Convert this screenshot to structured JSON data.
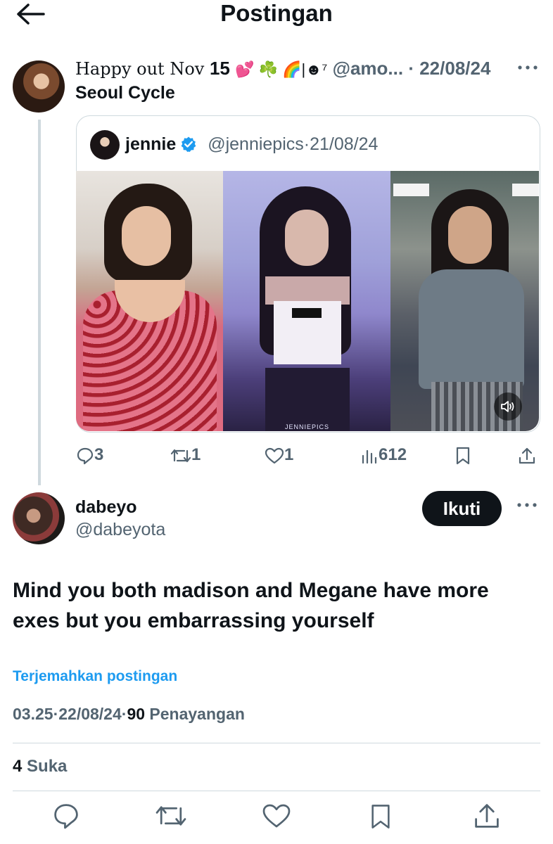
{
  "header": {
    "title": "Postingan"
  },
  "parent_post": {
    "display_name_prefix": "Happy out Nov ",
    "display_name_num": "15",
    "display_name_emoji": "💕 ☘️ 🌈|☻⁷",
    "handle": "@amo...",
    "separator": "·",
    "date": "22/08/24",
    "text": "Seoul Cycle",
    "quote": {
      "name": "jennie",
      "handle": "@jenniepics",
      "separator": "·",
      "date": "21/08/24",
      "watermark": "JENNIEPICS"
    },
    "actions": {
      "replies": "3",
      "reposts": "1",
      "likes": "1",
      "views": "612"
    }
  },
  "main_post": {
    "name": "dabeyo",
    "handle": "@dabeyota",
    "follow_label": "Ikuti",
    "text": "Mind you both madison and Megane have more exes but you embarrassing yourself",
    "translate_label": "Terjemahkan postingan",
    "time": "03.25",
    "sep1": "·",
    "date": "22/08/24",
    "sep2": "·",
    "views_count": "90",
    "views_label": " Penayangan",
    "likes_count": "4",
    "likes_label": " Suka"
  },
  "colors": {
    "text": "#0f1419",
    "muted": "#536471",
    "link": "#1d9bf0",
    "border": "#cfd9de",
    "verified": "#1d9bf0"
  },
  "icons": [
    "back-arrow-icon",
    "more-icon",
    "verified-icon",
    "reply-icon",
    "repost-icon",
    "like-icon",
    "views-icon",
    "bookmark-icon",
    "share-icon",
    "sound-icon"
  ]
}
